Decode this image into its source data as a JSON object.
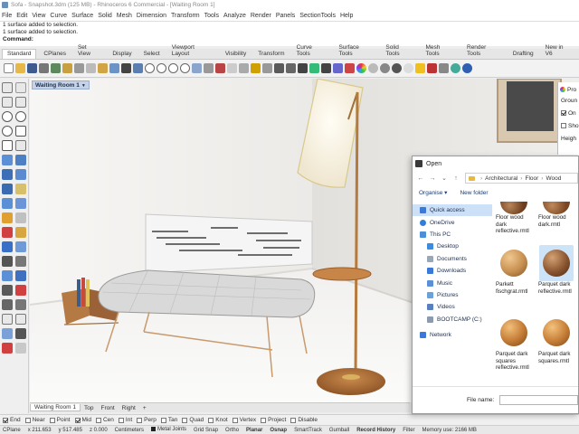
{
  "window": {
    "title": "Sofa - Snapshot.3dm (125 MB) - Rhinoceros 6 Commercial - [Waiting Room 1]"
  },
  "menu": [
    "File",
    "Edit",
    "View",
    "Curve",
    "Surface",
    "Solid",
    "Mesh",
    "Dimension",
    "Transform",
    "Tools",
    "Analyze",
    "Render",
    "Panels",
    "SectionTools",
    "Help"
  ],
  "command_history": [
    "1 surface added to selection.",
    "1 surface added to selection."
  ],
  "command_prompt": "Command:",
  "toolbar_tabs": [
    "Standard",
    "CPlanes",
    "Set View",
    "Display",
    "Select",
    "Viewport Layout",
    "Visibility",
    "Transform",
    "Curve Tools",
    "Surface Tools",
    "Solid Tools",
    "Mesh Tools",
    "Render Tools",
    "Drafting",
    "New in V6"
  ],
  "viewport": {
    "name": "Waiting Room 1",
    "dropdown": "▼"
  },
  "viewport_tabs": [
    "Waiting Room 1",
    "Top",
    "Front",
    "Right",
    "+"
  ],
  "osnap": [
    {
      "label": "End",
      "checked": true
    },
    {
      "label": "Near",
      "checked": false
    },
    {
      "label": "Point",
      "checked": false
    },
    {
      "label": "Mid",
      "checked": true
    },
    {
      "label": "Cen",
      "checked": false
    },
    {
      "label": "Int",
      "checked": false
    },
    {
      "label": "Perp",
      "checked": false
    },
    {
      "label": "Tan",
      "checked": false
    },
    {
      "label": "Quad",
      "checked": false
    },
    {
      "label": "Knot",
      "checked": false
    },
    {
      "label": "Vertex",
      "checked": false
    },
    {
      "label": "Project",
      "checked": false
    },
    {
      "label": "Disable",
      "checked": false
    }
  ],
  "status": {
    "cplane": "CPlane",
    "x": "x 211.653",
    "y": "y 517.485",
    "z": "z 0.000",
    "units": "Centimeters",
    "layer": "Metal Joints",
    "grid_snap": "Grid Snap",
    "ortho": "Ortho",
    "planar": "Planar",
    "osnap": "Osnap",
    "smarttrack": "SmartTrack",
    "gumball": "Gumball",
    "record_history": "Record History",
    "filter": "Filter",
    "memory": "Memory use: 2166 MB"
  },
  "open_dialog": {
    "title": "Open",
    "nav_buttons": [
      "←",
      "→",
      "⌄",
      "↑"
    ],
    "path": [
      "Architectural",
      "Floor",
      "Wood"
    ],
    "organise": "Organise ▾",
    "new_folder": "New folder",
    "tree": [
      {
        "label": "Quick access",
        "icon": "star-icon",
        "selected": true
      },
      {
        "label": "OneDrive",
        "icon": "cloud-icon",
        "selected": false
      },
      {
        "label": "This PC",
        "icon": "computer-icon",
        "selected": false
      },
      {
        "label": "Desktop",
        "icon": "desktop-icon",
        "selected": false
      },
      {
        "label": "Documents",
        "icon": "documents-icon",
        "selected": false
      },
      {
        "label": "Downloads",
        "icon": "downloads-icon",
        "selected": false
      },
      {
        "label": "Music",
        "icon": "music-icon",
        "selected": false
      },
      {
        "label": "Pictures",
        "icon": "pictures-icon",
        "selected": false
      },
      {
        "label": "Videos",
        "icon": "videos-icon",
        "selected": false
      },
      {
        "label": "BOOTCAMP (C:)",
        "icon": "drive-icon",
        "selected": false
      },
      {
        "label": "Network",
        "icon": "network-icon",
        "selected": false
      }
    ],
    "files": [
      {
        "name": "Floor wood dark reflective.rmtl",
        "color": "#6b3d1e",
        "selected": false
      },
      {
        "name": "Floor wood dark.rmtl",
        "color": "#7a4522",
        "selected": false
      },
      {
        "name": "Parkett fischgrat.rmtl",
        "color": "#c78f50",
        "selected": false
      },
      {
        "name": "Parquet dark reflective.rmtl",
        "color": "#8a5530",
        "selected": true
      },
      {
        "name": "Parquet dark squares reflective.rmtl",
        "color": "#c27a35",
        "selected": false
      },
      {
        "name": "Parquet dark squares.rmtl",
        "color": "#c57d36",
        "selected": false
      }
    ],
    "filename_label": "File name:"
  },
  "properties_panel": {
    "title": "Pro",
    "ground": "Groun",
    "on": "On",
    "show": "Sho",
    "height": "Heigh"
  }
}
